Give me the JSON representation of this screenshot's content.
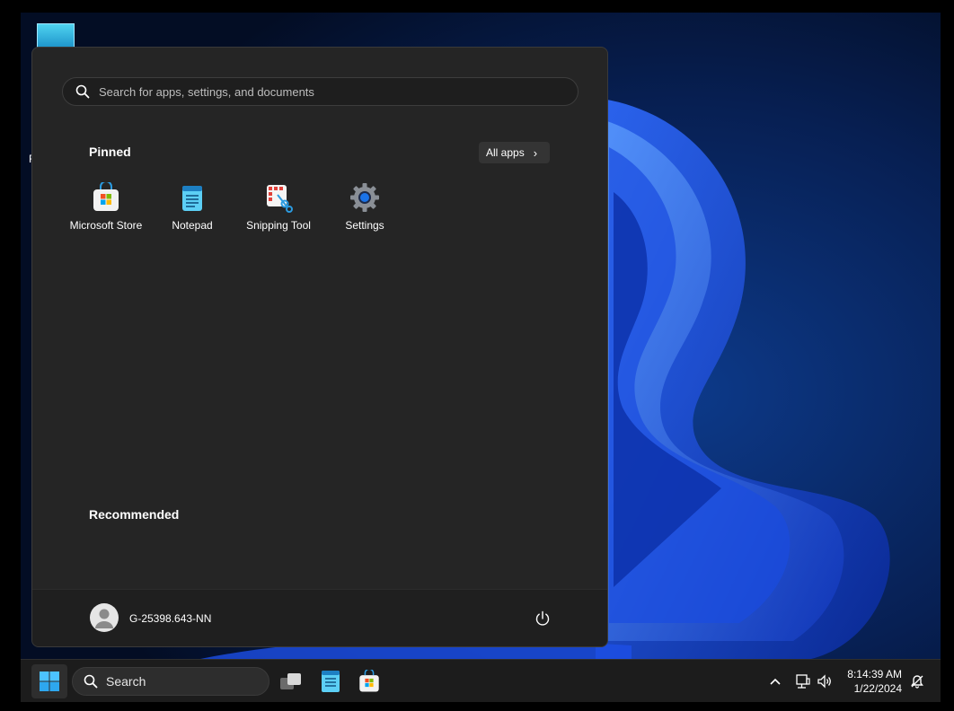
{
  "desktop": {
    "label_partial": "F"
  },
  "start_menu": {
    "search_placeholder": "Search for apps, settings, and documents",
    "pinned_title": "Pinned",
    "all_apps_label": "All apps",
    "pinned_apps": [
      {
        "label": "Microsoft Store",
        "icon": "microsoft-store-icon"
      },
      {
        "label": "Notepad",
        "icon": "notepad-icon"
      },
      {
        "label": "Snipping Tool",
        "icon": "snipping-tool-icon"
      },
      {
        "label": "Settings",
        "icon": "settings-gear-icon"
      }
    ],
    "recommended_title": "Recommended",
    "user_name": "G-25398.643-NN"
  },
  "taskbar": {
    "search_label": "Search",
    "time": "8:14:39 AM",
    "date": "1/22/2024"
  },
  "colors": {
    "menu_bg": "#252525",
    "taskbar_bg": "#1c1c1c",
    "accent": "#0078d4"
  }
}
